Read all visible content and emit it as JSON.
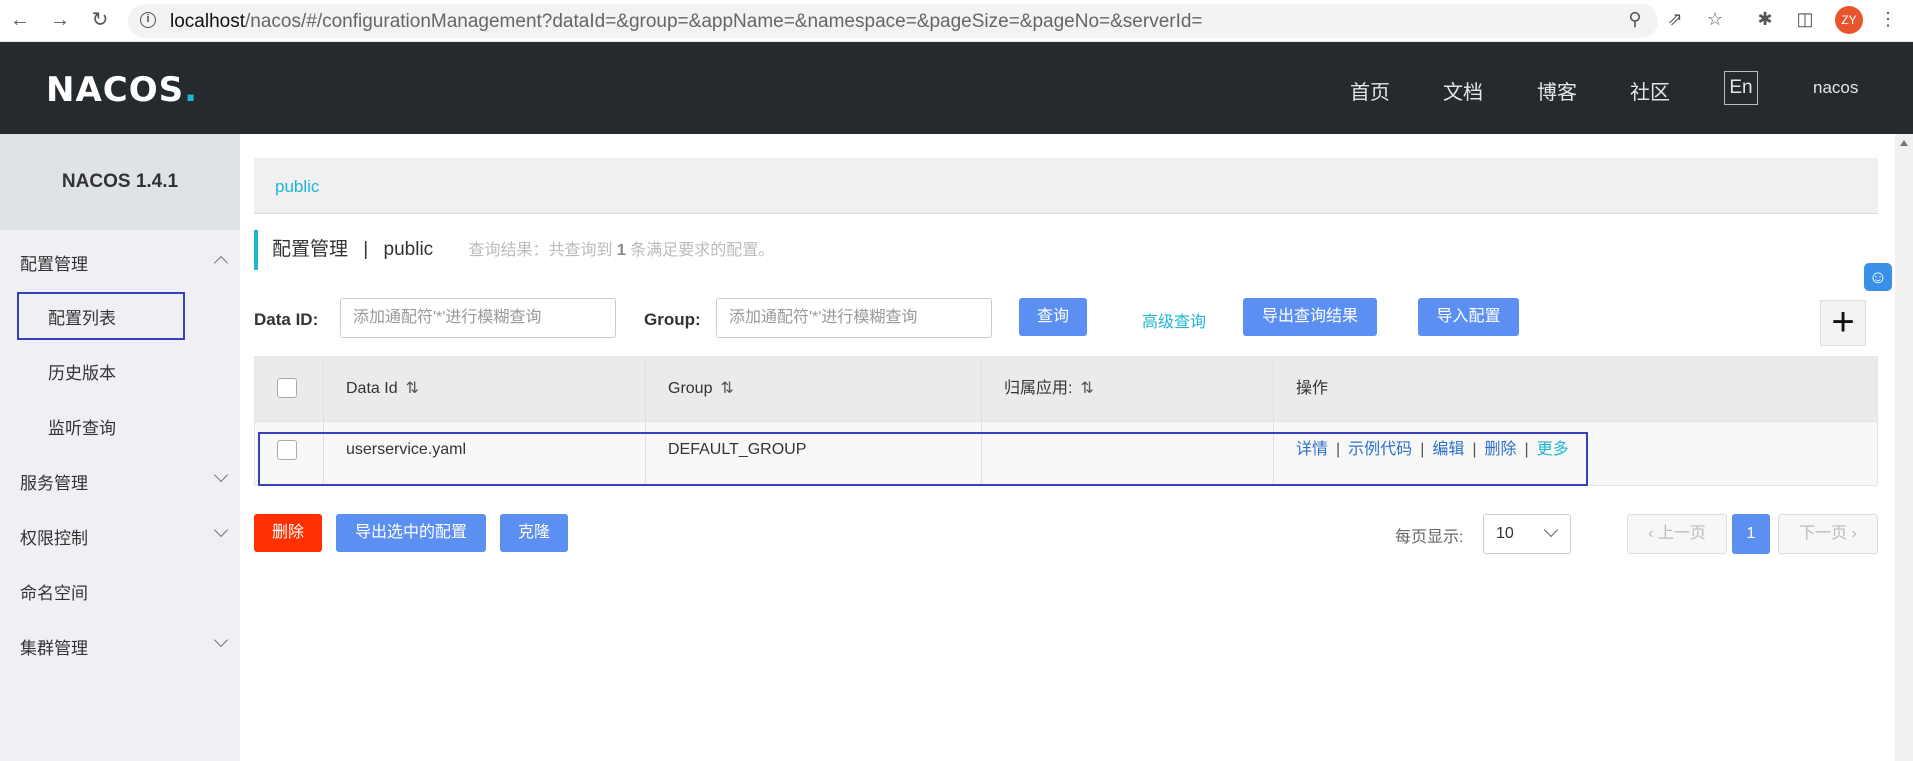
{
  "browser": {
    "url_host": "localhost",
    "url_rest": "/nacos/#/configurationManagement?dataId=&group=&appName=&namespace=&pageSize=&pageNo=&serverId=",
    "avatar": "ZY"
  },
  "header": {
    "logo": "NACOS",
    "nav": [
      "首页",
      "文档",
      "博客",
      "社区"
    ],
    "lang": "En",
    "user": "nacos"
  },
  "sidebar": {
    "version": "NACOS 1.4.1",
    "groups": [
      {
        "label": "配置管理",
        "expanded": true,
        "items": [
          "配置列表",
          "历史版本",
          "监听查询"
        ]
      },
      {
        "label": "服务管理",
        "expanded": false
      },
      {
        "label": "权限控制",
        "expanded": false
      },
      {
        "label": "命名空间"
      },
      {
        "label": "集群管理",
        "expanded": false
      }
    ]
  },
  "main": {
    "namespace": "public",
    "title": "配置管理",
    "title_sep": "|",
    "title_ns": "public",
    "hint_prefix": "查询结果：共查询到",
    "hint_count": "1",
    "hint_suffix": "条满足要求的配置。",
    "filters": {
      "dataid_label": "Data ID:",
      "dataid_placeholder": "添加通配符'*'进行模糊查询",
      "group_label": "Group:",
      "group_placeholder": "添加通配符'*'进行模糊查询"
    },
    "buttons": {
      "query": "查询",
      "advanced": "高级查询",
      "export_results": "导出查询结果",
      "import": "导入配置",
      "plus": "+"
    },
    "table": {
      "columns": [
        "Data Id",
        "Group",
        "归属应用:",
        "操作"
      ],
      "rows": [
        {
          "data_id": "userservice.yaml",
          "group": "DEFAULT_GROUP",
          "app": "",
          "ops": [
            "详情",
            "示例代码",
            "编辑",
            "删除",
            "更多"
          ]
        }
      ]
    },
    "bottom": {
      "delete": "删除",
      "export_selected": "导出选中的配置",
      "clone": "克隆",
      "page_size_label": "每页显示:",
      "page_size": "10",
      "prev": "上一页",
      "current_page": "1",
      "next": "下一页"
    }
  }
}
